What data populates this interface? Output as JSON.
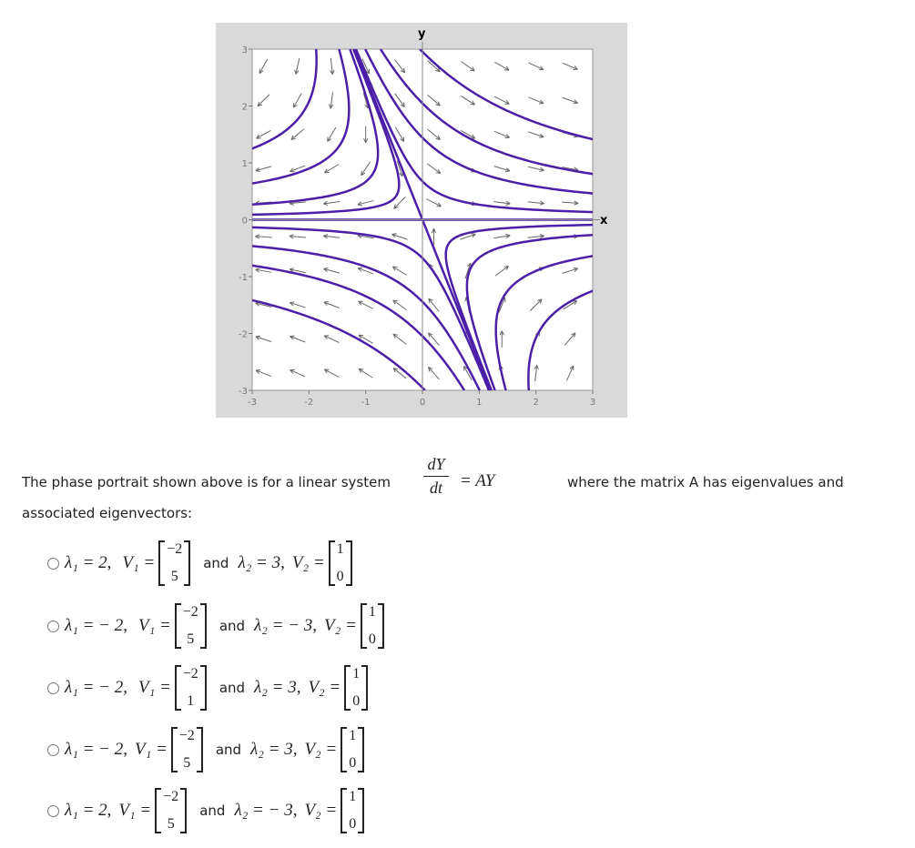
{
  "chart_data": {
    "type": "line",
    "title": "",
    "xlabel": "x",
    "ylabel": "y",
    "xlim": [
      -3,
      3
    ],
    "ylim": [
      -3,
      3
    ],
    "xticks": [
      "-3",
      "-2",
      "-1",
      "0",
      "1",
      "2",
      "3"
    ],
    "yticks": [
      "3",
      "2",
      "1",
      "0",
      "-1",
      "-2",
      "-3"
    ],
    "grid": false,
    "description_kind": "phase portrait with direction-field arrows and purple trajectories (saddle)",
    "colors": {
      "trajectory": "#4b1fa8",
      "arrow": "#666666",
      "frame": "#d9d9d9"
    }
  },
  "question": {
    "text_before": "The phase portrait shown above is for a linear system",
    "frac_num": "dY",
    "frac_den": "dt",
    "text_after_eq": "= AY",
    "text_after": "where the matrix A has eigenvalues and",
    "line2": "associated eigenvectors:"
  },
  "options": [
    {
      "l1": "λ₁ = 2,",
      "v1_label": "V₁ =",
      "v1": [
        "−2",
        "5"
      ],
      "and": "and",
      "l2": "λ₂ = 3,",
      "v2_label": "V₂ =",
      "v2": [
        "1",
        "0"
      ]
    },
    {
      "l1": "λ₁ = − 2,",
      "v1_label": "V₁ =",
      "v1": [
        "−2",
        "5"
      ],
      "and": "and",
      "l2": "λ₂ = − 3,",
      "v2_label": "V₂ =",
      "v2": [
        "1",
        "0"
      ]
    },
    {
      "l1": "λ₁ = − 2,",
      "v1_label": "V₁ =",
      "v1": [
        "−2",
        "1"
      ],
      "and": "and",
      "l2": "λ₂ = 3,",
      "v2_label": "V₂ =",
      "v2": [
        "1",
        "0"
      ]
    },
    {
      "l1": "λ₁ = − 2,",
      "v1_label": "V₁ =",
      "v1": [
        "−2",
        "5"
      ],
      "and": "and",
      "l2": "λ₂ = 3,",
      "v2_label": "V₂ =",
      "v2": [
        "1",
        "0"
      ]
    },
    {
      "l1": "λ₁ = 2,",
      "v1_label": "V₁ =",
      "v1": [
        "−2",
        "5"
      ],
      "and": "and",
      "l2": "λ₂ = − 3,",
      "v2_label": "V₂ =",
      "v2": [
        "1",
        "0"
      ]
    }
  ]
}
